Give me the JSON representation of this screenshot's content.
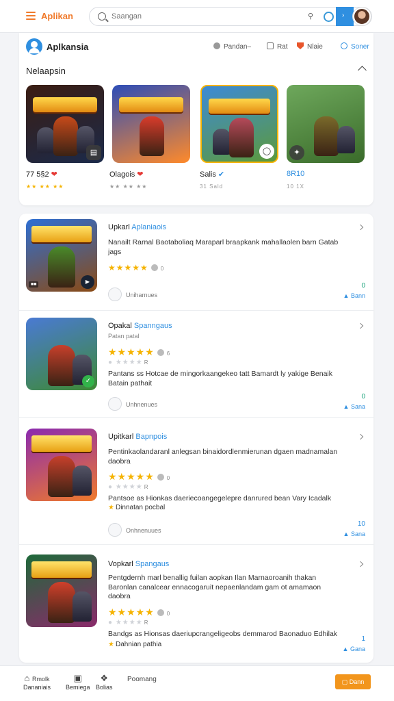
{
  "topbar": {
    "app_name": "Aplikan",
    "search_placeholder": "Saangan"
  },
  "header": {
    "brand": "Aplkansia",
    "links": [
      "Pandan–",
      "Rat",
      "Nlaie",
      "Soner"
    ]
  },
  "featured": {
    "title": "Nelaapsin",
    "games": [
      {
        "label": "77 5§2",
        "sub": "★★ ★★ ★★",
        "icon": "heart-icon",
        "art_title": "SPRRNDAS",
        "bg": [
          "#3b1d12",
          "#1b2a4a"
        ],
        "accent": "#c74a1a"
      },
      {
        "label": "Olagois",
        "sub": "★★ ★★ ★★",
        "icon": "heart-icon",
        "art_title": "VIAIKO",
        "bg": [
          "#2c4db8",
          "#ff8a2a"
        ],
        "accent": "#d93c2b"
      },
      {
        "label": "Salis",
        "sub": "31 Sald",
        "icon": "verified-icon",
        "art_title": "SHAIPAX",
        "bg": [
          "#3d8ad6",
          "#5c9a3b"
        ],
        "accent": "#b54a5a"
      },
      {
        "label": "8R10",
        "sub": "10 1X",
        "icon": "none",
        "art_title": "",
        "bg": [
          "#6ea85c",
          "#3a6b2a"
        ],
        "accent": "#7a6a2a"
      }
    ]
  },
  "list": [
    {
      "title": "Upkarl",
      "title_accent": "Aplaniaois",
      "desc": "Nanailt Rarnal Baotaboliaq Maraparl braapkank mahallaolen barn Gatab jags",
      "rating_count": "0",
      "developer": "Uniharnues",
      "right_num": "0",
      "right_label": "Bann",
      "art_title": "SHIRRRAS",
      "bg": [
        "#2d6fd4",
        "#8a4a14"
      ],
      "accent": "#4a8a2a",
      "corner": "play"
    },
    {
      "title": "Opakal",
      "title_accent": "Spanngaus",
      "subtitle": "Patan patal",
      "rating_count": "6",
      "grey_count": "R",
      "desc": "Pantans ss Hotcae de mingorkaangekeo tatt Bamardt ly yakige Benaik Batain pathait",
      "developer": "Unhnenues",
      "right_num": "0",
      "right_label": "Sana",
      "art_title": "",
      "bg": [
        "#4a7ad4",
        "#3e8a34"
      ],
      "accent": "#c7402b",
      "corner": "ok"
    },
    {
      "title": "Upitkarl",
      "title_accent": "Bapnpois",
      "desc": "Pentinkaolandaranl anlegsan binaidordlenmierunan dgaen madnamalan daobra",
      "rating_count": "0",
      "grey_count": "R",
      "desc2": "Pantsoe as Hionkas daeriecoangegelepre danrured bean Vary Icadalk",
      "note": "Dinnatan pocbal",
      "developer": "Onhnenuues",
      "right_num": "10",
      "right_label": "Sana",
      "art_title": "NRACHAIN",
      "bg": [
        "#8a2ab0",
        "#f07a2b"
      ],
      "accent": "#c7402b",
      "corner": "none"
    },
    {
      "title": "Vopkarl",
      "title_accent": "Spangaus",
      "desc": "Pentgdernh marl benallig fuilan aopkan Ilan Marnaoroanih thakan Baronlan canalcear ennacogaruit nepaenlandam gam ot amamaon daobra",
      "rating_count": "0",
      "grey_count": "R",
      "desc2": "Bandgs as Hionsas daeriupcrangeligeobs demmarod Baonaduo Edhilak",
      "note": "Dahnian pathia",
      "right_num": "1",
      "right_label": "Gana",
      "art_title": "WEARFANS",
      "bg": [
        "#1e6a3a",
        "#8a2a6a"
      ],
      "accent": "#d0402b",
      "corner": "none"
    }
  ],
  "bottom": {
    "nav": [
      {
        "label": "Rmolk",
        "sub": "Dananiais"
      },
      {
        "label": "",
        "sub": "Bemiega"
      },
      {
        "label": "",
        "sub": "Bolias"
      }
    ],
    "center": "Poomang",
    "button": "Dann"
  },
  "colors": {
    "accent": "#2f8fe0",
    "brand": "#f07a2b",
    "star": "#f5b301"
  }
}
